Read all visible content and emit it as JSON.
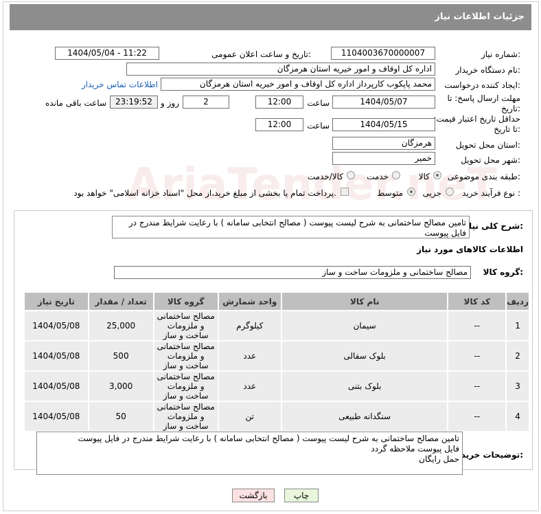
{
  "header": {
    "title": "جزئیات اطلاعات نیاز"
  },
  "fields": {
    "need_number_label": "شماره نیاز:",
    "need_number": "1104003670000007",
    "announce_label": "تاریخ و ساعت اعلان عمومی:",
    "announce_value": "1404/05/04 - 11:22",
    "buyer_org_label": "نام دستگاه خریدار:",
    "buyer_org": "اداره کل اوقاف و امور خیریه استان هرمزگان",
    "requester_label": "ایجاد کننده درخواست:",
    "requester": "محمد پاپکوب کارپرداز اداره کل اوقاف و امور خیریه استان هرمزگان",
    "contact_link": "اطلاعات تماس خریدار",
    "deadline_label": "مهلت ارسال پاسخ: تا تاریخ:",
    "deadline_date": "1404/05/07",
    "time_label": "ساعت",
    "deadline_time": "12:00",
    "days": "2",
    "days_label": "روز و",
    "remaining_time": "23:19:52",
    "remaining_label": "ساعت باقی مانده",
    "min_validity_label": "حداقل تاریخ اعتبار قیمت: تا تاریخ:",
    "validity_date": "1404/05/15",
    "validity_time": "12:00",
    "province_label": "استان محل تحویل:",
    "province": "هرمزگان",
    "city_label": "شهر محل تحویل:",
    "city": "خمیر",
    "category_label": "طبقه بندی موضوعی:",
    "category_options": [
      "کالا",
      "خدمت",
      "کالا/خدمت"
    ],
    "process_label": "نوع فرآیند خرید :",
    "process_options": [
      "جزیی",
      "متوسط"
    ],
    "payment_note": "پرداخت تمام یا بخشی از مبلغ خرید،از محل \"اسناد خزانه اسلامی\" خواهد بود."
  },
  "description": {
    "label": "شرح کلی نیاز:",
    "text": "تامین مصالح ساختمانی به شرح لیست پیوست ( مصالح انتخابی سامانه )  با رعایت شرایط مندرج در فایل پیوست"
  },
  "goods": {
    "section_title": "اطلاعات کالاهای مورد نیاز",
    "group_label": "گروه کالا:",
    "group_value": "مصالح ساختمانی و ملزومات ساخت و ساز",
    "columns": [
      "ردیف",
      "کد کالا",
      "نام کالا",
      "واحد شمارش",
      "گروه کالا",
      "تعداد / مقدار",
      "تاریخ نیاز"
    ],
    "rows": [
      {
        "idx": "1",
        "code": "--",
        "name": "سیمان",
        "unit": "کیلوگرم",
        "group": "مصالح ساختمانی و ملزومات ساخت و ساز",
        "qty": "25,000",
        "date": "1404/05/08"
      },
      {
        "idx": "2",
        "code": "--",
        "name": "بلوک سفالی",
        "unit": "عدد",
        "group": "مصالح ساختمانی و ملزومات ساخت و ساز",
        "qty": "500",
        "date": "1404/05/08"
      },
      {
        "idx": "3",
        "code": "--",
        "name": "بلوک بتنی",
        "unit": "عدد",
        "group": "مصالح ساختمانی و ملزومات ساخت و ساز",
        "qty": "3,000",
        "date": "1404/05/08"
      },
      {
        "idx": "4",
        "code": "--",
        "name": "سنگدانه طبیعی",
        "unit": "تن",
        "group": "مصالح ساختمانی و ملزومات ساخت و ساز",
        "qty": "50",
        "date": "1404/05/08"
      }
    ]
  },
  "buyer_notes": {
    "label": "توضیحات خریدار:",
    "line1": "تامین مصالح ساختمانی به شرح لیست پیوست ( مصالح انتخابی سامانه )  با رعایت شرایط مندرج در فایل پیوست",
    "line2": "فایل پیوست ملاحظه گردد",
    "line3": "حمل رایگان"
  },
  "buttons": {
    "print": "چاپ",
    "back": "بازگشت"
  },
  "watermark": "AriaTender.neT"
}
